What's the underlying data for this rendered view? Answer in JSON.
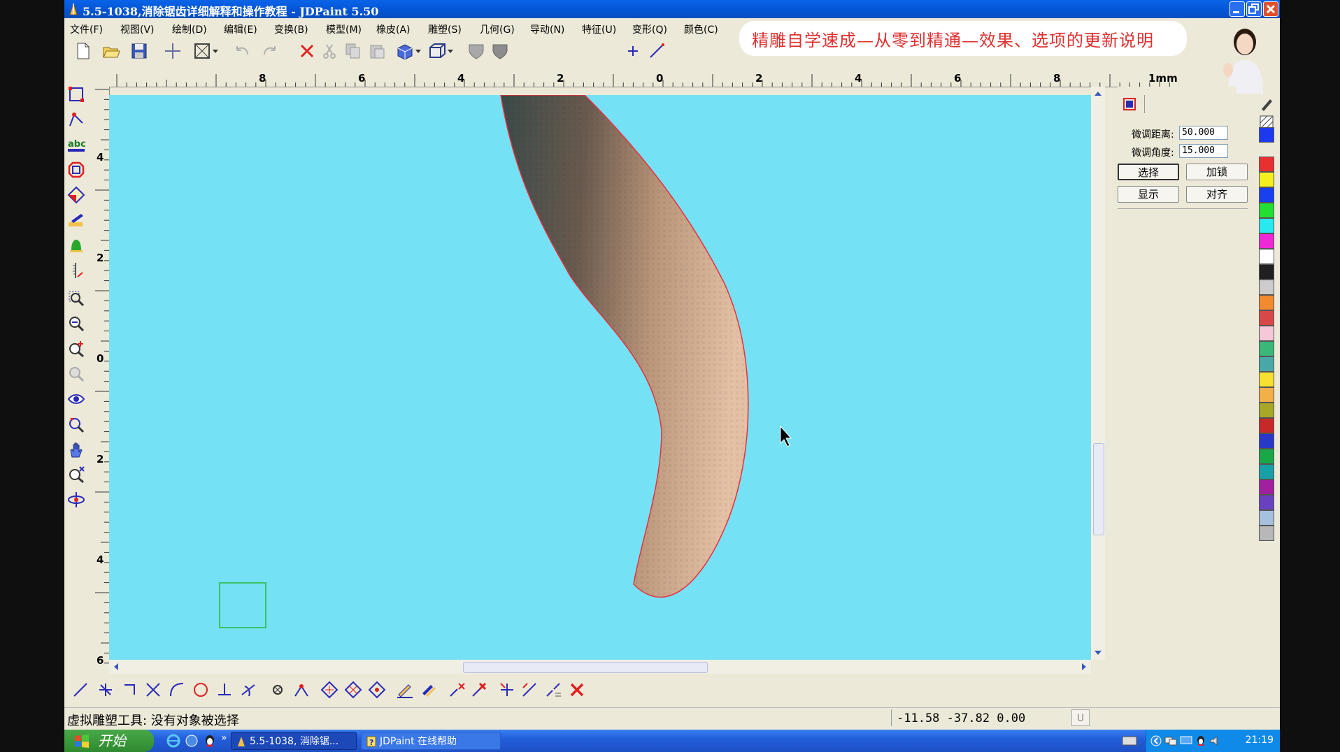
{
  "window": {
    "title": "5.5-1038,消除锯齿详细解释和操作教程 - JDPaint 5.50"
  },
  "menu": [
    "文件(F)",
    "视图(V)",
    "绘制(D)",
    "编辑(E)",
    "变换(B)",
    "模型(M)",
    "橡皮(A)",
    "雕塑(S)",
    "几何(G)",
    "导动(N)",
    "特征(U)",
    "变形(Q)",
    "颜色(C)"
  ],
  "banner": {
    "text": "精雕自学速成—从零到精通—效果、选项的更新说明"
  },
  "ruler": {
    "top_labels": [
      "8",
      "6",
      "4",
      "2",
      "0",
      "2",
      "4",
      "6",
      "8"
    ],
    "unit": "1mm",
    "left_labels": [
      "4",
      "2",
      "0",
      "2",
      "4",
      "6"
    ]
  },
  "panel": {
    "nudge_distance_label": "微调距离:",
    "nudge_distance_value": "50.000",
    "nudge_angle_label": "微调角度:",
    "nudge_angle_value": "15.000",
    "btn_select": "选择",
    "btn_lock": "加锁",
    "btn_show": "显示",
    "btn_align": "对齐"
  },
  "status": {
    "message": "虚拟雕塑工具: 没有对象被选择",
    "coords": "-11.58  -37.82  0.00",
    "indicator": "U"
  },
  "taskbar": {
    "start": "开始",
    "tasks": [
      "5.5-1038, 消除锯...",
      "JDPaint 在线帮助"
    ],
    "clock": "21:19"
  },
  "colors": {
    "canvas": "#74e2f4",
    "titlebar": "#0a5ae0",
    "banner_text": "#e03030",
    "palette": [
      "#1d39f0",
      "#e83030",
      "#f4f020",
      "#1840ee",
      "#22e032",
      "#28e8f0",
      "#f028d8",
      "#ffffff",
      "#202020",
      "#cccccc",
      "#f28a30",
      "#d84848",
      "#f4c8d8",
      "#3ab87a",
      "#48a8a8",
      "#f8e030",
      "#f4b048",
      "#a8a828",
      "#c82828",
      "#2838c8",
      "#18a848",
      "#18a0a8",
      "#a020a0",
      "#6840c0",
      "#a8c0e0",
      "#b8b8b8"
    ]
  }
}
